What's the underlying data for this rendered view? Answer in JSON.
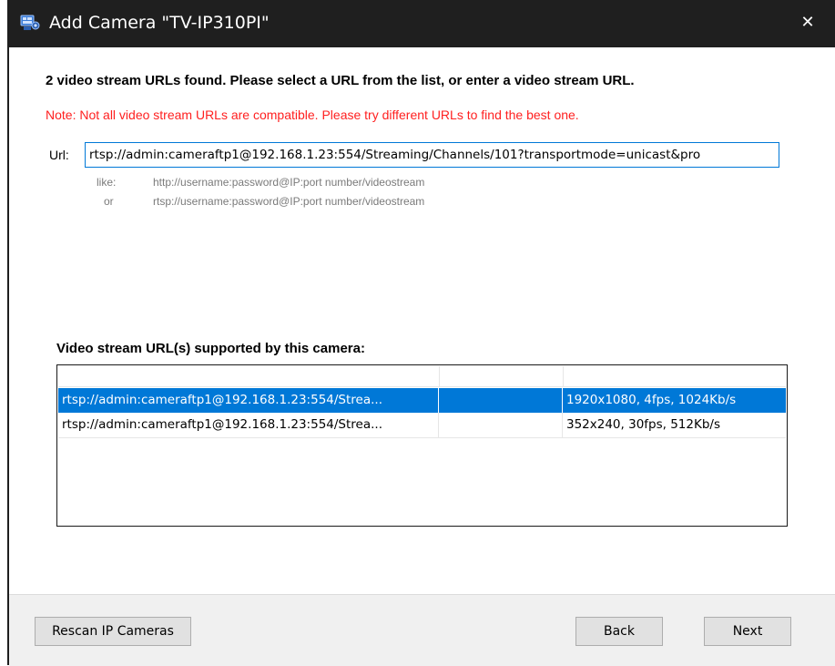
{
  "window": {
    "title": "Add Camera \"TV-IP310PI\"",
    "close_glyph": "✕",
    "title_icon": "camera-app-icon"
  },
  "main": {
    "heading": "2 video stream URLs found. Please select a URL from the list, or enter a video stream URL.",
    "note": "Note: Not all video stream URLs are compatible. Please try different URLs to find the best one.",
    "url_label": "Url:",
    "url_value": "rtsp://admin:cameraftp1@192.168.1.23:554/Streaming/Channels/101?transportmode=unicast&pro",
    "hints": {
      "like_label": "like:",
      "or_label": "or",
      "http_example": "http://username:password@IP:port number/videostream",
      "rtsp_example": "rtsp://username:password@IP:port number/videostream"
    },
    "list_title": "Video stream URL(s) supported by this camera:",
    "rows": [
      {
        "url": "rtsp://admin:cameraftp1@192.168.1.23:554/Strea...",
        "col2": "",
        "info": "1920x1080, 4fps, 1024Kb/s",
        "selected": true
      },
      {
        "url": "rtsp://admin:cameraftp1@192.168.1.23:554/Strea...",
        "col2": "",
        "info": "352x240, 30fps, 512Kb/s",
        "selected": false
      }
    ]
  },
  "footer": {
    "rescan_label": "Rescan IP Cameras",
    "back_label": "Back",
    "next_label": "Next"
  },
  "colors": {
    "titlebar": "#1f1f1f",
    "note": "#ff2020",
    "selection": "#0078d7",
    "input_border": "#0078d7"
  }
}
